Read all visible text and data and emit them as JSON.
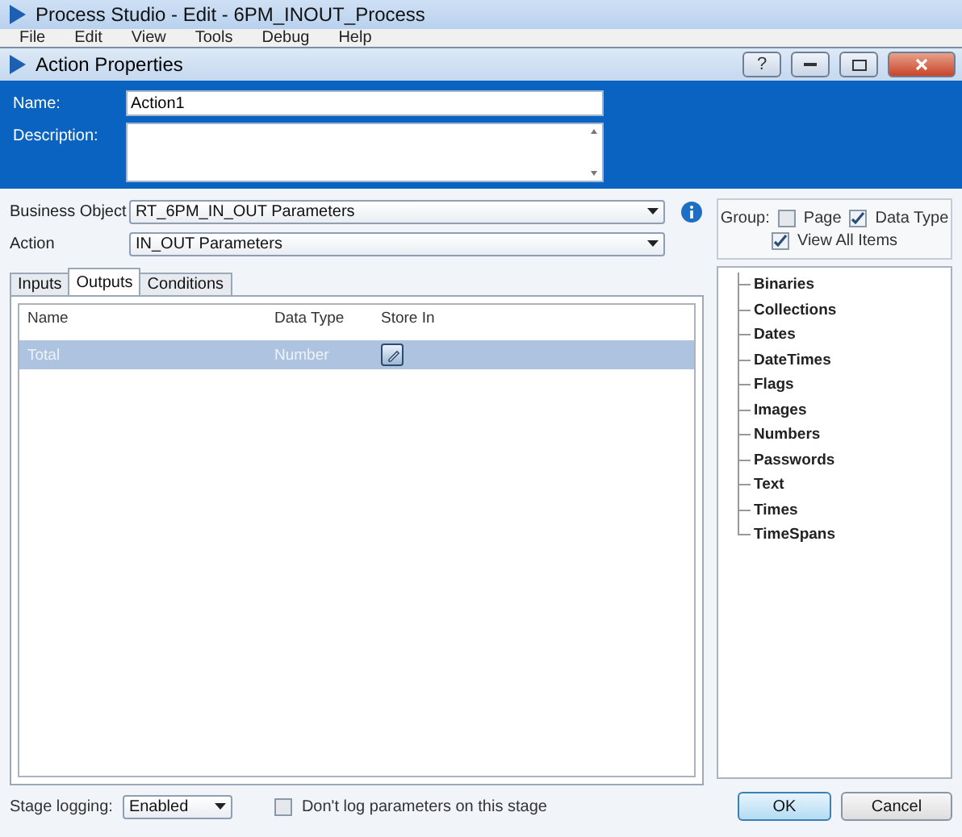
{
  "main_window": {
    "title": "Process Studio  - Edit - 6PM_INOUT_Process",
    "menu": [
      "File",
      "Edit",
      "View",
      "Tools",
      "Debug",
      "Help"
    ]
  },
  "dialog": {
    "title": "Action Properties",
    "help_button": "?"
  },
  "name": {
    "label": "Name:",
    "value": "Action1"
  },
  "description": {
    "label": "Description:"
  },
  "business_object": {
    "label": "Business Object",
    "value": "RT_6PM_IN_OUT Parameters"
  },
  "action": {
    "label": "Action",
    "value": "IN_OUT Parameters"
  },
  "tabs": [
    {
      "label": "Inputs",
      "selected": false
    },
    {
      "label": "Outputs",
      "selected": true
    },
    {
      "label": "Conditions",
      "selected": false
    }
  ],
  "table": {
    "columns": [
      "Name",
      "Data Type",
      "Store In"
    ],
    "rows": [
      {
        "name": "Total",
        "data_type": "Number",
        "selected": true
      }
    ]
  },
  "group": {
    "label": "Group:",
    "options": [
      {
        "label": "Page",
        "checked": false
      },
      {
        "label": "Data Type",
        "checked": true
      }
    ],
    "view_all": {
      "label": "View All Items",
      "checked": true
    }
  },
  "tree": [
    "Binaries",
    "Collections",
    "Dates",
    "DateTimes",
    "Flags",
    "Images",
    "Numbers",
    "Passwords",
    "Text",
    "Times",
    "TimeSpans"
  ],
  "stage_logging": {
    "label": "Stage logging:",
    "value": "Enabled"
  },
  "dont_log": {
    "label": "Don't log parameters on this stage",
    "checked": false
  },
  "buttons": [
    {
      "label": "OK",
      "kind": "primary"
    },
    {
      "label": "Cancel",
      "kind": "normal"
    }
  ]
}
